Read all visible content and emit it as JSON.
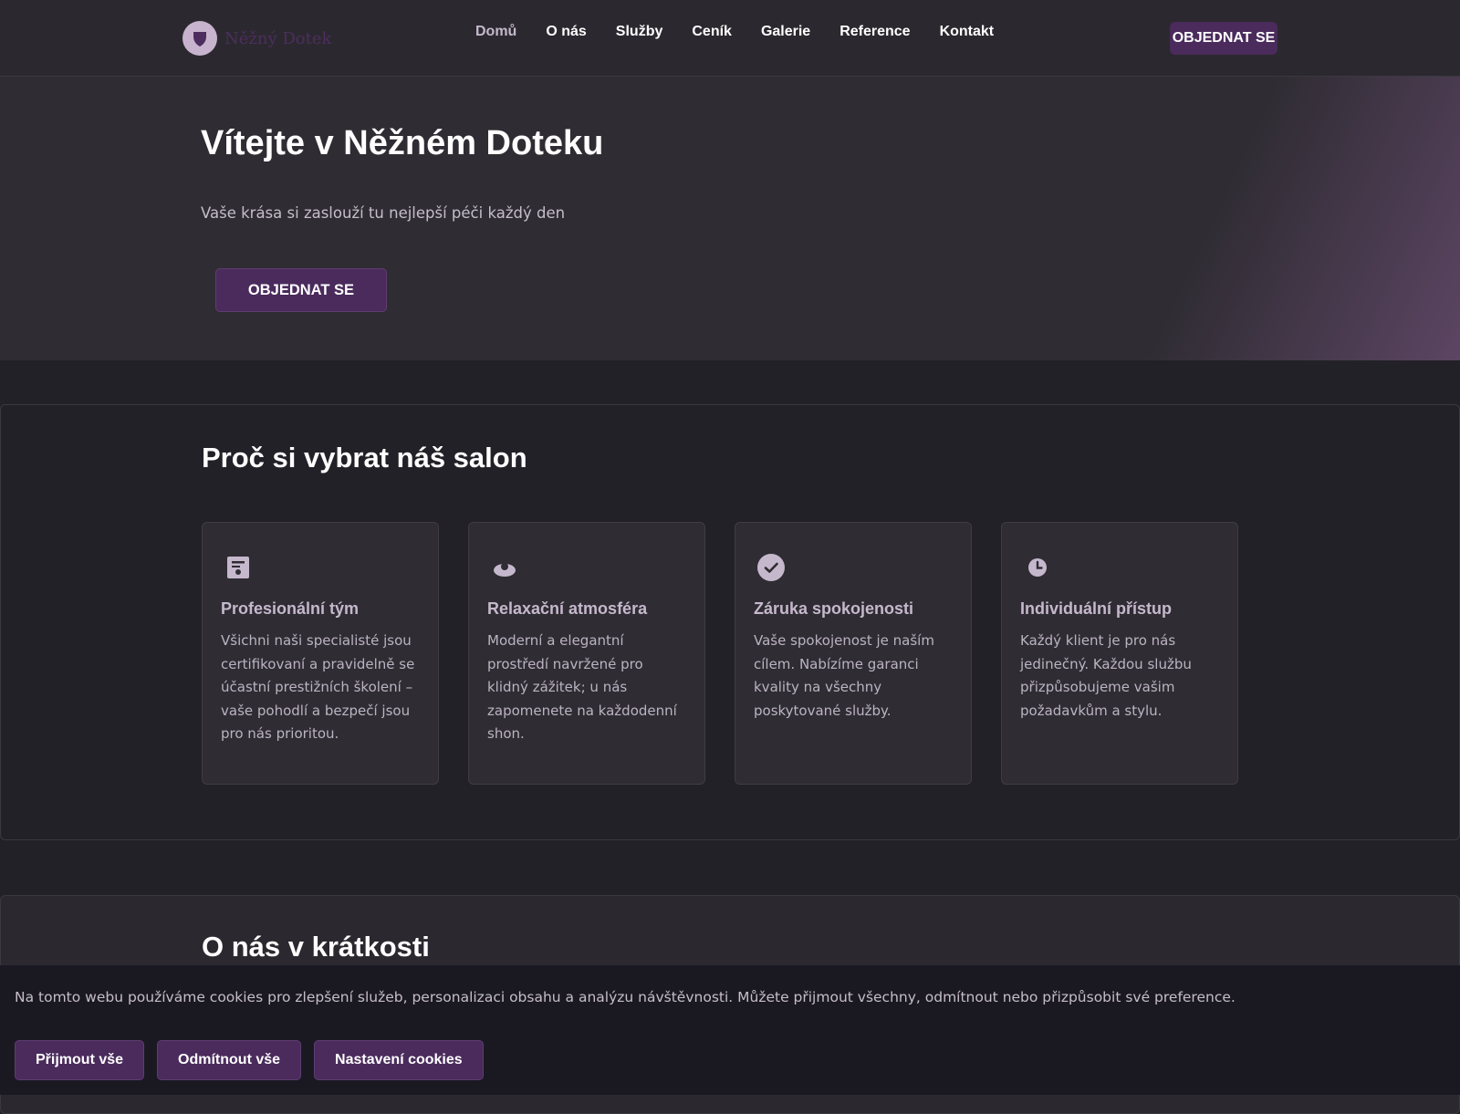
{
  "header": {
    "brand_name": "Něžný Dotek",
    "nav": [
      "Domů",
      "O nás",
      "Služby",
      "Ceník",
      "Galerie",
      "Reference",
      "Kontakt"
    ],
    "active_nav": "Domů",
    "cta_label": "OBJEDNAT SE"
  },
  "hero": {
    "title": "Vítejte v Něžném Doteku",
    "subtitle": "Vaše krása si zaslouží tu nejlepší péči každý den",
    "cta_label": "OBJEDNAT SE"
  },
  "why": {
    "title": "Proč si vybrat náš salon",
    "cards": [
      {
        "icon": "calculator-icon",
        "title": "Profesionální tým",
        "text": "Všichni naši specialisté jsou certifikovaní a pravidelně se účastní prestižních školení – vaše pohodlí a bezpečí jsou pro nás prioritou."
      },
      {
        "icon": "bowl-icon",
        "title": "Relaxační atmosféra",
        "text": "Moderní a elegantní prostředí navržené pro klidný zážitek; u nás zapomenete na každodenní shon."
      },
      {
        "icon": "check-circle-icon",
        "title": "Záruka spokojenosti",
        "text": "Vaše spokojenost je naším cílem. Nabízíme garanci kvality na všechny poskytované služby."
      },
      {
        "icon": "clock-icon",
        "title": "Individuální přístup",
        "text": "Každý klient je pro nás jedinečný. Každou službu přizpůsobujeme vašim požadavkům a stylu."
      }
    ]
  },
  "about": {
    "title": "O nás v krátkosti"
  },
  "cookies": {
    "text": "Na tomto webu používáme cookies pro zlepšení služeb, personalizaci obsahu a analýzu návštěvnosti. Můžete přijmout všechny, odmítnout nebo přizpůsobit své preference.",
    "accept_label": "Přijmout vše",
    "reject_label": "Odmítnout vše",
    "settings_label": "Nastavení cookies"
  },
  "colors": {
    "accent": "#4a2b5c",
    "accent_light": "#c5b8cc",
    "background": "#222128"
  }
}
